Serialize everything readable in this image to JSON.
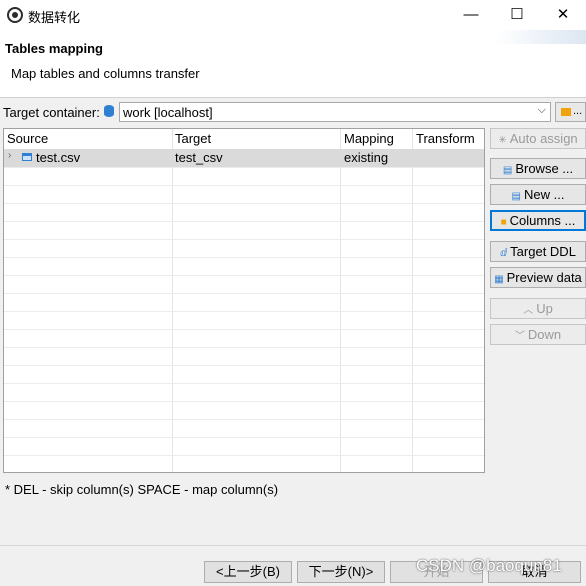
{
  "window": {
    "title": "数据转化",
    "minimize": "—",
    "maximize": "☐",
    "close": "✕"
  },
  "header": {
    "title": "Tables mapping",
    "description": "Map tables and columns transfer"
  },
  "target_container": {
    "label": "Target container:",
    "value": "work  [localhost]",
    "browse_dots": "..."
  },
  "table": {
    "columns": [
      "Source",
      "Target",
      "Mapping",
      "Transform"
    ],
    "rows": [
      {
        "source": "test.csv",
        "target": "test_csv",
        "mapping": "existing",
        "transform": ""
      }
    ]
  },
  "buttons": {
    "auto_assign": "Auto assign",
    "browse": "Browse ...",
    "new": "New ...",
    "columns": "Columns ...",
    "target_ddl": "Target DDL",
    "preview_data": "Preview data",
    "up": "Up",
    "down": "Down"
  },
  "hint": "* DEL - skip column(s)  SPACE - map column(s)",
  "footer": {
    "back": "<上一步(B)",
    "next": "下一步(N)>",
    "start": "开始",
    "cancel": "取消"
  },
  "watermark": "CSDN @baoqun81"
}
